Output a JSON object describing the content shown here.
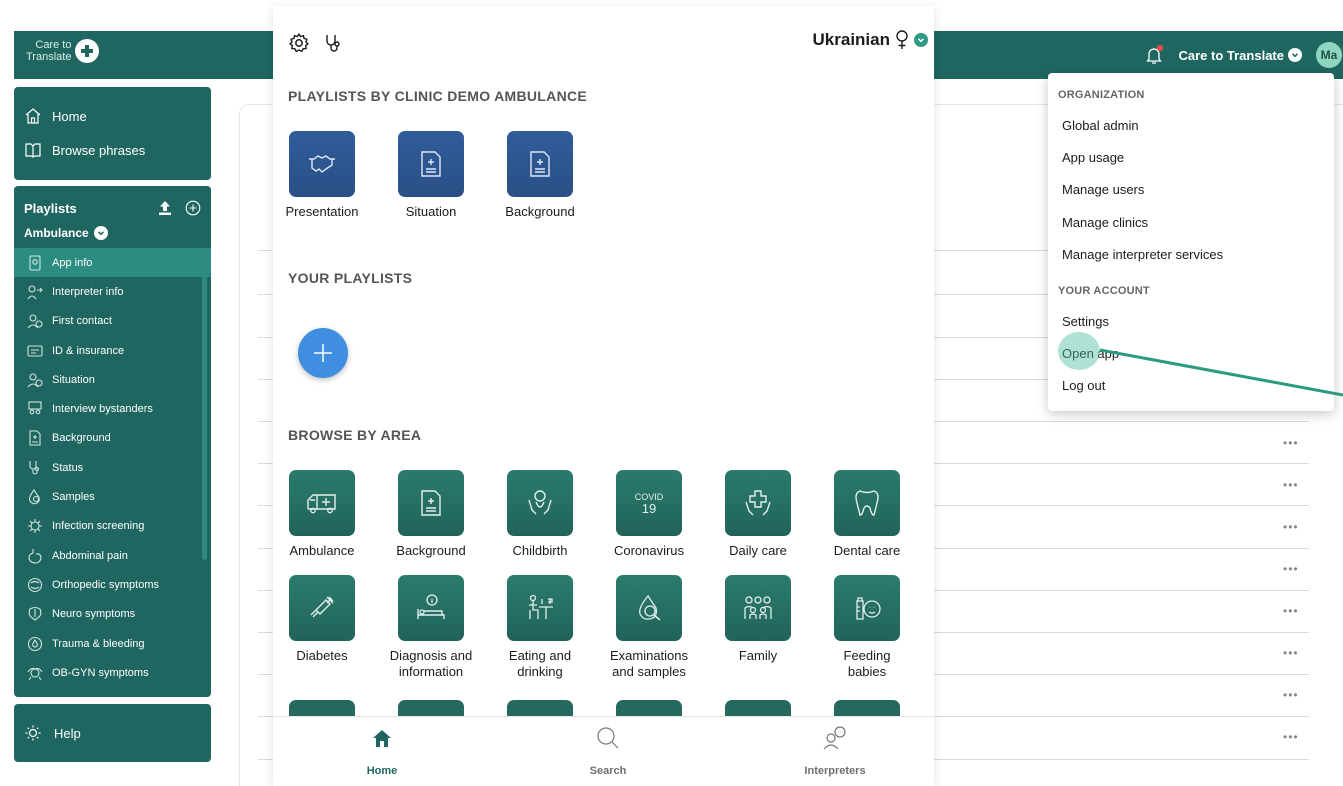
{
  "topbar": {
    "logo_text_line1": "Care to",
    "logo_text_line2": "Translate",
    "org_name": "Care to Translate",
    "avatar_initials": "Ma"
  },
  "nav": {
    "home": "Home",
    "browse_phrases": "Browse phrases",
    "playlists_title": "Playlists",
    "playlist_selected": "Ambulance",
    "items": [
      {
        "label": "App info",
        "icon": "phone-info-icon",
        "active": true
      },
      {
        "label": "Interpreter info",
        "icon": "interpreter-icon"
      },
      {
        "label": "First contact",
        "icon": "first-contact-icon"
      },
      {
        "label": "ID & insurance",
        "icon": "id-card-icon"
      },
      {
        "label": "Situation",
        "icon": "situation-icon"
      },
      {
        "label": "Interview bystanders",
        "icon": "bystanders-icon"
      },
      {
        "label": "Background",
        "icon": "document-icon"
      },
      {
        "label": "Status",
        "icon": "stethoscope-icon"
      },
      {
        "label": "Samples",
        "icon": "samples-icon"
      },
      {
        "label": "Infection screening",
        "icon": "virus-icon"
      },
      {
        "label": "Abdominal pain",
        "icon": "stomach-icon"
      },
      {
        "label": "Orthopedic symptoms",
        "icon": "bone-icon"
      },
      {
        "label": "Neuro symptoms",
        "icon": "brain-icon"
      },
      {
        "label": "Trauma & bleeding",
        "icon": "bleeding-icon"
      },
      {
        "label": "OB-GYN symptoms",
        "icon": "obgyn-icon"
      }
    ],
    "help": "Help"
  },
  "phone": {
    "language": "Ukrainian",
    "clinic_section_title": "PLAYLISTS BY CLINIC DEMO AMBULANCE",
    "clinic_tiles": [
      "Presentation",
      "Situation",
      "Background"
    ],
    "your_playlists_title": "YOUR PLAYLISTS",
    "browse_area_title": "BROWSE BY AREA",
    "areas_row1": [
      "Ambulance",
      "Background",
      "Childbirth",
      "Coronavirus",
      "Daily care",
      "Dental care"
    ],
    "areas_row2": [
      {
        "l1": "Diabetes",
        "l2": ""
      },
      {
        "l1": "Diagnosis and",
        "l2": "information"
      },
      {
        "l1": "Eating and",
        "l2": "drinking"
      },
      {
        "l1": "Examinations",
        "l2": "and samples"
      },
      {
        "l1": "Family",
        "l2": ""
      },
      {
        "l1": "Feeding",
        "l2": "babies"
      }
    ],
    "covid_l1": "COVID",
    "covid_l2": "19",
    "tabs": [
      "Home",
      "Search",
      "Interpreters"
    ]
  },
  "dropdown": {
    "org_header": "ORGANIZATION",
    "org_items": [
      "Global admin",
      "App usage",
      "Manage users",
      "Manage clinics",
      "Manage interpreter services"
    ],
    "account_header": "YOUR ACCOUNT",
    "account_items": [
      "Settings",
      "Open app",
      "Log out"
    ]
  },
  "background_rows": {
    "more_label": "•••"
  },
  "colors": {
    "brand_teal": "#1f6660",
    "active_item": "#2d8c80",
    "tile_blue": "#2f5d9a",
    "tile_green": "#2b7b6d",
    "add_button": "#3f8ee0"
  }
}
